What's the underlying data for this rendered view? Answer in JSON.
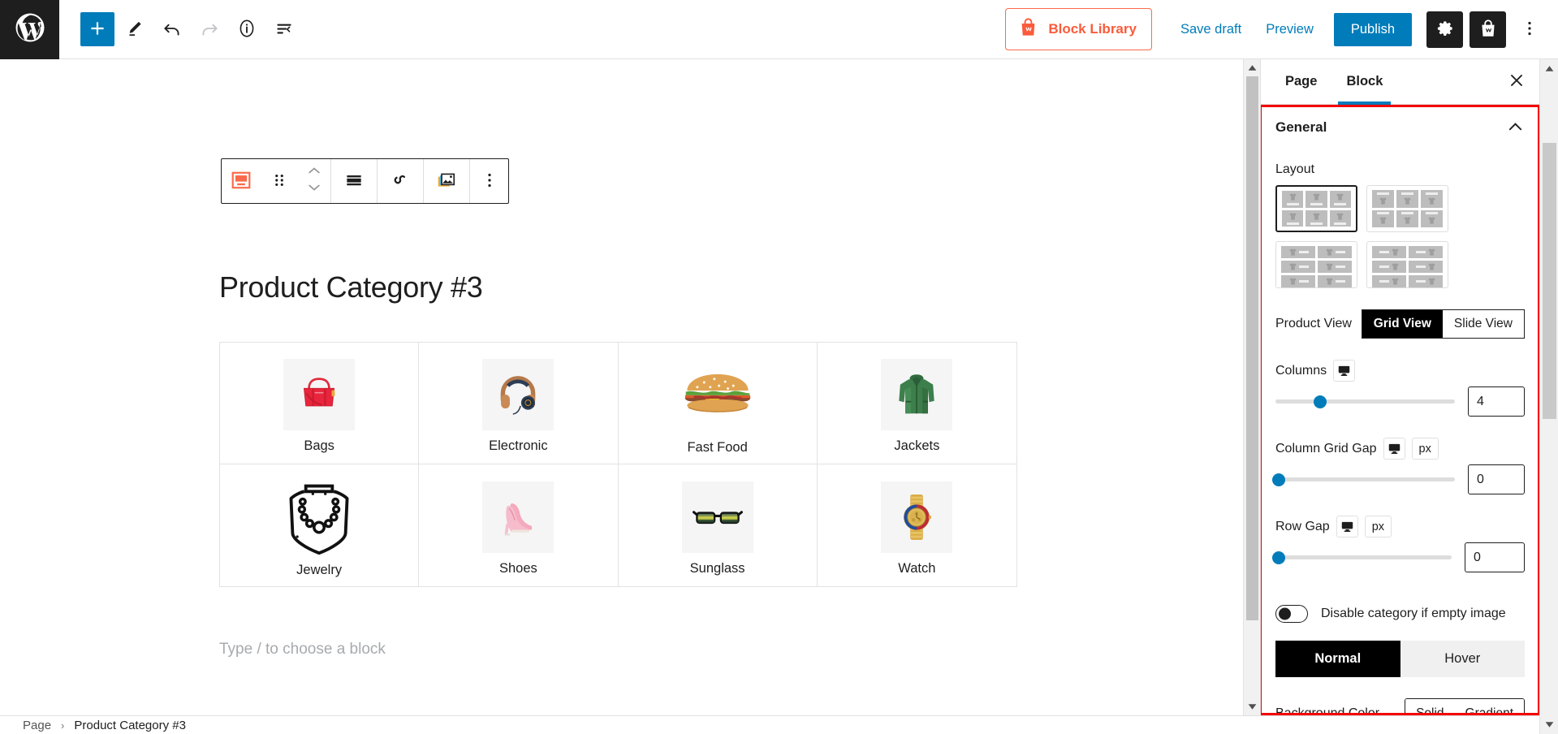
{
  "topbar": {
    "logo_icon": "wordpress-icon",
    "tools": [
      {
        "name": "add-block-button",
        "icon": "plus-icon",
        "label": "Add block"
      },
      {
        "name": "edit-tool-button",
        "icon": "pencil-icon",
        "label": "Edit"
      },
      {
        "name": "undo-button",
        "icon": "undo-icon",
        "label": "Undo"
      },
      {
        "name": "redo-button",
        "icon": "redo-icon",
        "label": "Redo"
      },
      {
        "name": "details-button",
        "icon": "info-icon",
        "label": "Details"
      },
      {
        "name": "list-view-button",
        "icon": "list-view-icon",
        "label": "List View"
      }
    ],
    "block_library_label": "Block Library",
    "block_library_icon": "shopping-bag-w-icon",
    "save_draft_label": "Save draft",
    "preview_label": "Preview",
    "publish_label": "Publish",
    "settings_icon": "gear-icon",
    "store_icon": "shopping-bag-icon",
    "more_icon": "vertical-dots-icon"
  },
  "block_toolbar": {
    "items": [
      {
        "name": "block-type-button",
        "icon": "product-category-block-icon"
      },
      {
        "name": "drag-handle",
        "icon": "drag-dots-icon"
      },
      {
        "name": "move-updown-button",
        "icon": "chevron-updown-icon"
      },
      {
        "name": "align-button",
        "icon": "align-full-width-icon"
      },
      {
        "name": "co-block-button",
        "icon": "co-blocks-icon"
      },
      {
        "name": "image-settings-button",
        "icon": "image-stack-icon"
      },
      {
        "name": "block-options-button",
        "icon": "vertical-dots-icon"
      }
    ]
  },
  "canvas": {
    "post_title": "Product Category #3",
    "placeholder": "Type / to choose a block",
    "categories": [
      {
        "label": "Bags",
        "image": "red-handbag",
        "boxed": true
      },
      {
        "label": "Electronic",
        "image": "headphones",
        "boxed": true
      },
      {
        "label": "Fast Food",
        "image": "burger",
        "boxed": false
      },
      {
        "label": "Jackets",
        "image": "green-jacket",
        "boxed": true
      },
      {
        "label": "Jewelry",
        "image": "necklace-lineart",
        "boxed": false
      },
      {
        "label": "Shoes",
        "image": "pink-heels",
        "boxed": true
      },
      {
        "label": "Sunglass",
        "image": "sunglasses",
        "boxed": true
      },
      {
        "label": "Watch",
        "image": "gold-watch",
        "boxed": true
      }
    ]
  },
  "sidebar": {
    "tabs": [
      {
        "label": "Page",
        "active": false
      },
      {
        "label": "Block",
        "active": true
      }
    ],
    "close_icon": "close-icon",
    "panel": {
      "title": "General",
      "collapse_icon": "chevron-up-icon",
      "layout_label": "Layout",
      "layouts": [
        {
          "name": "layout-grid-image-top",
          "cols": 3,
          "rows": 2,
          "orientation": "vertical",
          "bar_first": false,
          "selected": true
        },
        {
          "name": "layout-grid-label-top",
          "cols": 3,
          "rows": 2,
          "orientation": "vertical",
          "bar_first": true,
          "selected": false
        },
        {
          "name": "layout-list-image-left",
          "cols": 2,
          "rows": 3,
          "orientation": "horizontal",
          "bar_first": false,
          "selected": false
        },
        {
          "name": "layout-list-label-left",
          "cols": 2,
          "rows": 3,
          "orientation": "horizontal",
          "bar_first": true,
          "selected": false
        }
      ],
      "product_view_label": "Product View",
      "product_view_options": [
        {
          "label": "Grid View",
          "active": true
        },
        {
          "label": "Slide View",
          "active": false
        }
      ],
      "columns_label": "Columns",
      "columns_device_icon": "desktop-icon",
      "columns_value": "4",
      "columns_slider_percent": 25,
      "column_gap_label": "Column Grid Gap",
      "column_gap_device_icon": "desktop-icon",
      "column_gap_unit": "px",
      "column_gap_value": "0",
      "column_gap_slider_percent": 0,
      "row_gap_label": "Row Gap",
      "row_gap_device_icon": "desktop-icon",
      "row_gap_unit": "px",
      "row_gap_value": "0",
      "row_gap_slider_percent": 0,
      "disable_empty_label": "Disable category if empty image",
      "disable_empty_on": false,
      "state_tabs": [
        {
          "label": "Normal",
          "active": true
        },
        {
          "label": "Hover",
          "active": false
        }
      ],
      "background_color_label": "Background Color",
      "background_color_options": [
        {
          "label": "Solid",
          "active": false
        },
        {
          "label": "Gradient",
          "active": false
        }
      ]
    }
  },
  "footer": {
    "breadcrumbs": [
      "Page",
      "Product Category #3"
    ],
    "separator": "›"
  },
  "colors": {
    "accent_blue": "#007cba",
    "brand_orange": "#fb5b3b",
    "highlight_red": "#f40000",
    "dark": "#1e1e1e"
  }
}
